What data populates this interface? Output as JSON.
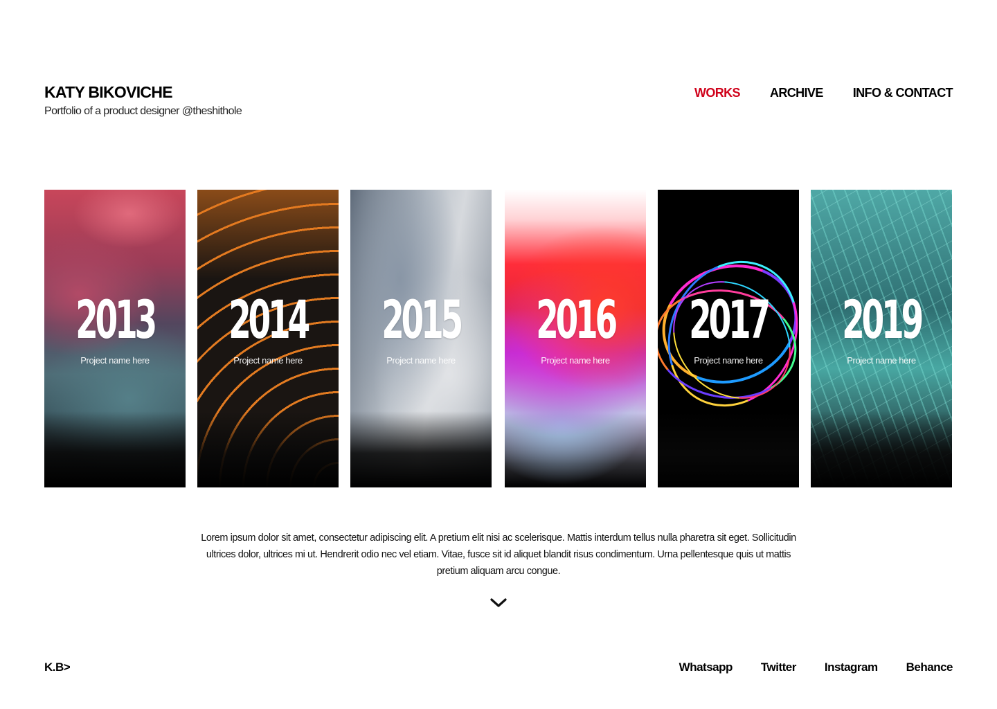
{
  "header": {
    "name": "KATY BIKOVICHE",
    "tagline": "Portfolio of a product designer @theshithole",
    "nav": [
      {
        "label": "WORKS",
        "active": true
      },
      {
        "label": "ARCHIVE",
        "active": false
      },
      {
        "label": "INFO & CONTACT",
        "active": false
      }
    ],
    "active_color": "#d0021b"
  },
  "works": [
    {
      "year": "2013",
      "project": "Project name here"
    },
    {
      "year": "2014",
      "project": "Project name here"
    },
    {
      "year": "2015",
      "project": "Project name here"
    },
    {
      "year": "2016",
      "project": "Project name here"
    },
    {
      "year": "2017",
      "project": "Project name here"
    },
    {
      "year": "2019",
      "project": "Project name here"
    }
  ],
  "description": "Lorem ipsum dolor sit amet, consectetur adipiscing elit. A pretium elit nisi ac scelerisque. Mattis interdum tellus nulla pharetra sit eget. Sollicitudin ultrices dolor, ultrices mi ut. Hendrerit odio nec vel etiam. Vitae, fusce sit id aliquet blandit risus condimentum. Urna pellentesque quis ut mattis pretium aliquam arcu congue.",
  "scroll_icon": "chevron-down-icon",
  "footer": {
    "logo": "K.B>",
    "social": [
      "Whatsapp",
      "Twitter",
      "Instagram",
      "Behance"
    ]
  }
}
